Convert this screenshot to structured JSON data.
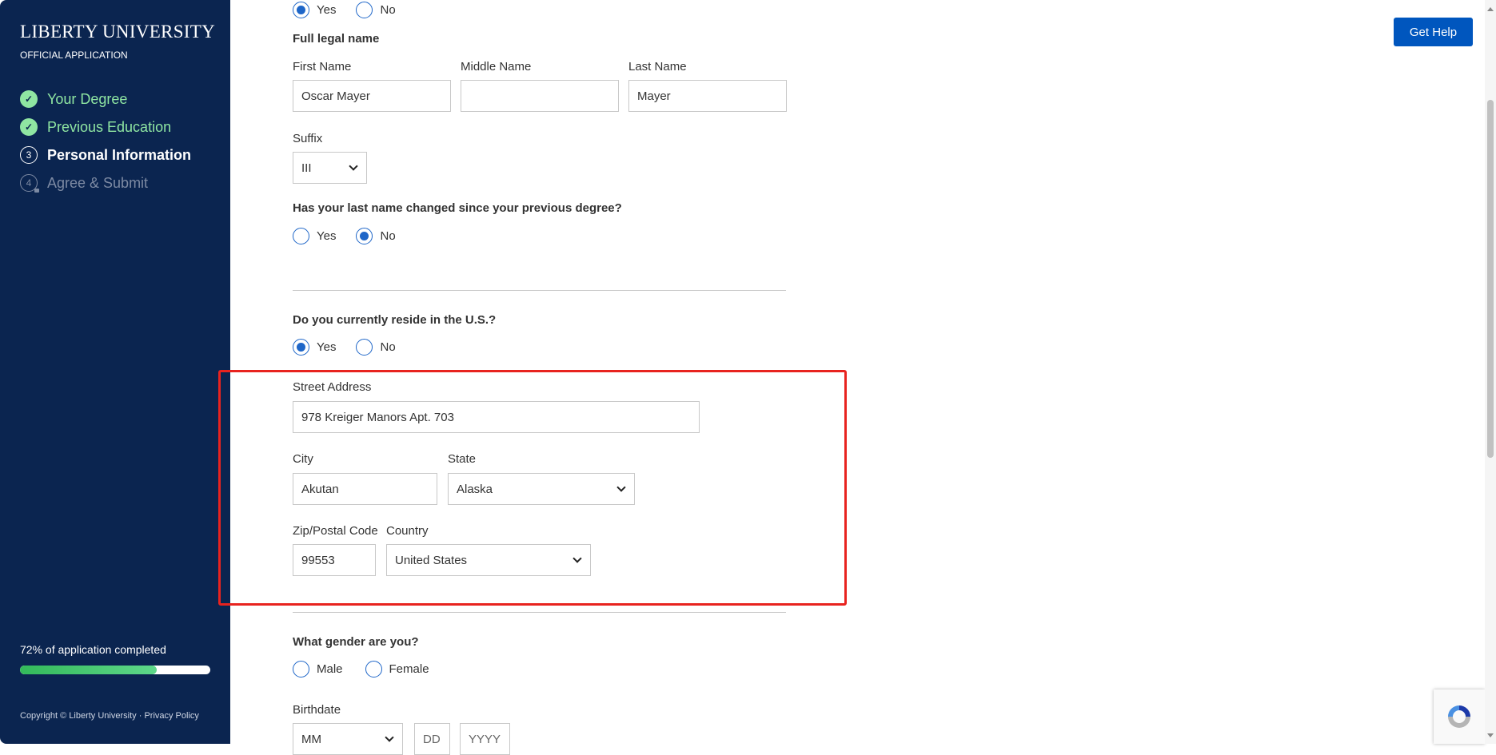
{
  "sidebar": {
    "logo": "LIBERTY UNIVERSITY",
    "subtitle": "OFFICIAL APPLICATION",
    "steps": [
      {
        "label": "Your Degree",
        "state": "done",
        "icon": "check-icon"
      },
      {
        "label": "Previous Education",
        "state": "done",
        "icon": "check-icon"
      },
      {
        "label": "Personal Information",
        "state": "current",
        "number": "3"
      },
      {
        "label": "Agree & Submit",
        "state": "locked",
        "number": "4"
      }
    ],
    "progress_text": "72% of application completed",
    "progress_percent": 72,
    "copyright": "Copyright © Liberty University",
    "separator": " · ",
    "privacy": "Privacy Policy"
  },
  "header": {
    "help_label": "Get Help",
    "help_color": "#0056be"
  },
  "form": {
    "top_radio": {
      "options": [
        "Yes",
        "No"
      ],
      "selected": "Yes"
    },
    "full_name": {
      "heading": "Full legal name",
      "first_label": "First Name",
      "first_value": "Oscar Mayer",
      "middle_label": "Middle Name",
      "middle_value": "",
      "last_label": "Last Name",
      "last_value": "Mayer",
      "suffix_label": "Suffix",
      "suffix_value": "III"
    },
    "name_changed": {
      "question": "Has your last name changed since your previous degree?",
      "options": [
        "Yes",
        "No"
      ],
      "selected": "No"
    },
    "reside_us": {
      "question": "Do you currently reside in the U.S.?",
      "options": [
        "Yes",
        "No"
      ],
      "selected": "Yes"
    },
    "address": {
      "street_label": "Street Address",
      "street_value": "978 Kreiger Manors Apt. 703",
      "city_label": "City",
      "city_value": "Akutan",
      "state_label": "State",
      "state_value": "Alaska",
      "zip_label": "Zip/Postal Code",
      "zip_value": "99553",
      "country_label": "Country",
      "country_value": "United States"
    },
    "gender": {
      "question": "What gender are you?",
      "options": [
        "Male",
        "Female"
      ],
      "selected": null
    },
    "birthdate": {
      "label": "Birthdate",
      "month_placeholder": "MM",
      "day_placeholder": "DD",
      "year_placeholder": "YYYY"
    }
  },
  "colors": {
    "sidebar_bg": "#0b2550",
    "accent": "#1e66c8",
    "done_green": "#8fe6a2",
    "highlight_box": "#e8231f"
  }
}
